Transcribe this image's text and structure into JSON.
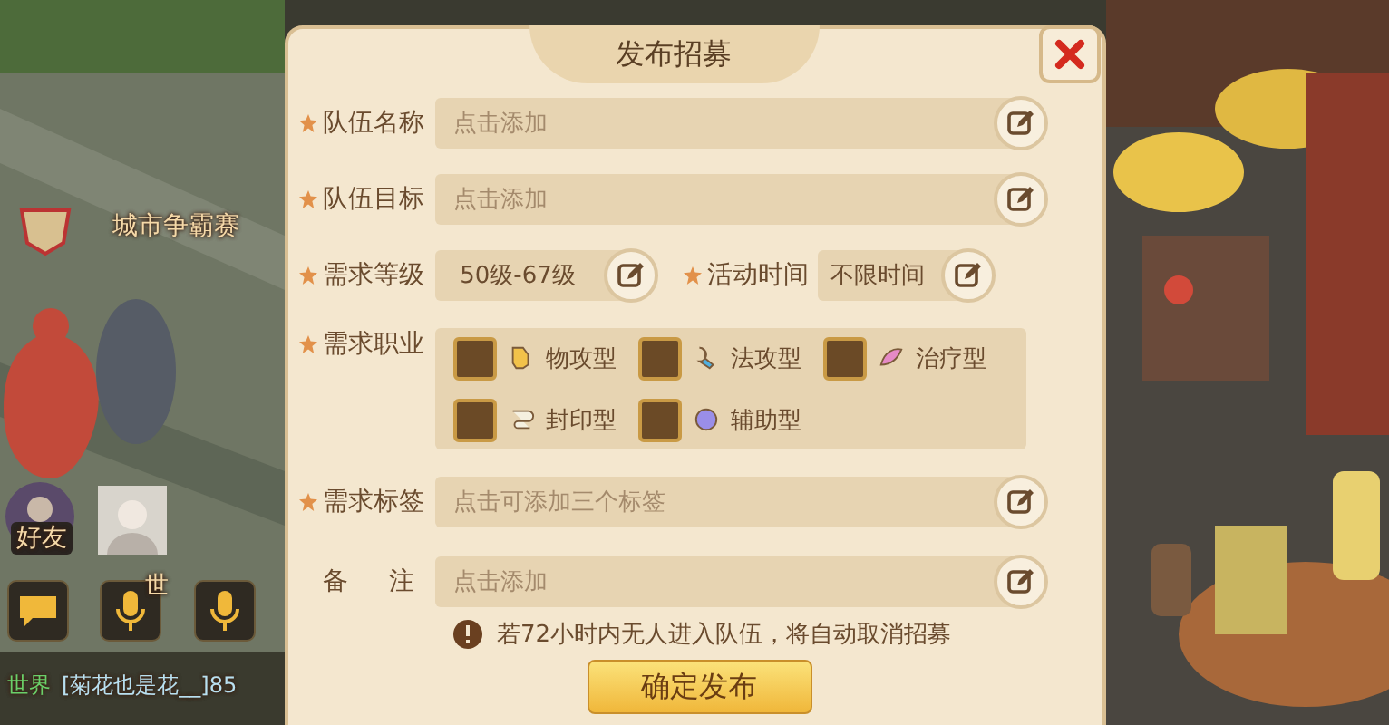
{
  "hud": {
    "event_label": "城市争霸赛",
    "friends_label": "好友",
    "channel_badge": "世",
    "chat": {
      "channel": "世界",
      "text": "[菊花也是花__]85"
    }
  },
  "dialog": {
    "title": "发布招募",
    "rows": [
      {
        "kind": "input",
        "label": "队伍名称",
        "required": true,
        "placeholder": "点击添加"
      },
      {
        "kind": "input",
        "label": "队伍目标",
        "required": true,
        "placeholder": "点击添加"
      },
      {
        "kind": "pair",
        "items": [
          {
            "label": "需求等级",
            "required": true,
            "value": "50级-67级"
          },
          {
            "label": "活动时间",
            "required": true,
            "value": "不限时间"
          }
        ]
      },
      {
        "kind": "jobs",
        "label": "需求职业",
        "required": true,
        "options": [
          {
            "label": "物攻型",
            "checked": false
          },
          {
            "label": "法攻型",
            "checked": false
          },
          {
            "label": "治疗型",
            "checked": false
          },
          {
            "label": "封印型",
            "checked": false
          },
          {
            "label": "辅助型",
            "checked": false
          }
        ]
      },
      {
        "kind": "input",
        "label": "需求标签",
        "required": true,
        "placeholder": "点击可添加三个标签"
      },
      {
        "kind": "input",
        "label": "备 注",
        "required": false,
        "placeholder": "点击添加"
      }
    ],
    "notice": "若72小时内无人进入队伍，将自动取消招募",
    "confirm": "确定发布"
  }
}
